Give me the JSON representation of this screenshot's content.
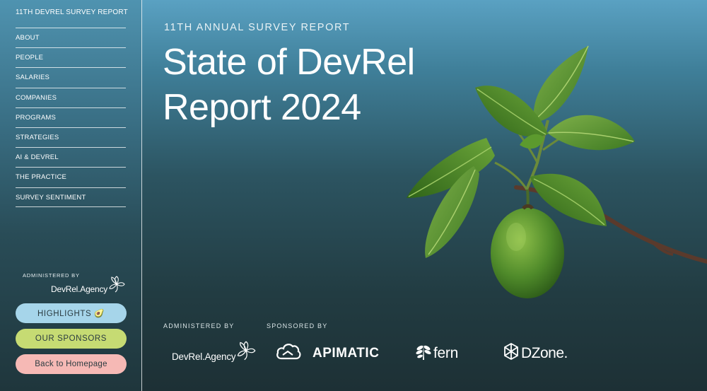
{
  "sidebar": {
    "site_title": "11TH DEVREL SURVEY REPORT",
    "items": [
      {
        "label": "ABOUT"
      },
      {
        "label": "PEOPLE"
      },
      {
        "label": "SALARIES"
      },
      {
        "label": "COMPANIES"
      },
      {
        "label": "PROGRAMS"
      },
      {
        "label": "STRATEGIES"
      },
      {
        "label": "AI & DEVREL"
      },
      {
        "label": "THE PRACTICE"
      },
      {
        "label": "SURVEY SENTIMENT"
      }
    ],
    "administered_label": "ADMINISTERED BY",
    "administered_logo": "DevRel.Agency",
    "buttons": {
      "highlights": "HIGHLIGHTS 🥑",
      "sponsors": "OUR SPONSORS",
      "home": "Back to Homepage"
    }
  },
  "hero": {
    "kicker": "11TH ANNUAL SURVEY REPORT",
    "title_line1": "State of DevRel",
    "title_line2": "Report 2024"
  },
  "footer": {
    "administered_label": "ADMINISTERED BY",
    "sponsored_label": "SPONSORED BY",
    "logos": {
      "devrel": "DevRel.Agency",
      "apimatic": "APIMATIC",
      "fern": "fern",
      "dzone": "DZone."
    }
  },
  "icons": {
    "devrel": "leaf-flower-icon",
    "apimatic": "cloud-icon",
    "fern": "fern-leaf-icon",
    "dzone": "hexagon-icon",
    "hero_art": "avocado-branch-illustration"
  },
  "colors": {
    "highlights": "#a6d5ea",
    "sponsors": "#c6db73",
    "home": "#f6b9b5"
  }
}
